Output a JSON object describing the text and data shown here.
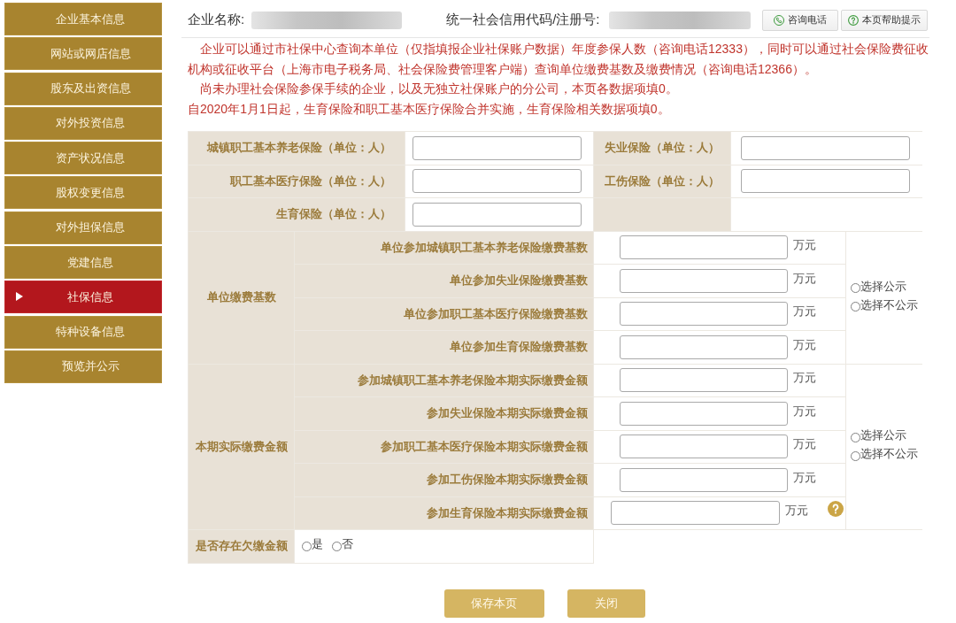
{
  "sidebar": {
    "items": [
      {
        "label": "企业基本信息",
        "selected": false
      },
      {
        "label": "网站或网店信息",
        "selected": false
      },
      {
        "label": "股东及出资信息",
        "selected": false
      },
      {
        "label": "对外投资信息",
        "selected": false
      },
      {
        "label": "资产状况信息",
        "selected": false
      },
      {
        "label": "股权变更信息",
        "selected": false
      },
      {
        "label": "对外担保信息",
        "selected": false
      },
      {
        "label": "党建信息",
        "selected": false
      },
      {
        "label": "社保信息",
        "selected": true
      },
      {
        "label": "特种设备信息",
        "selected": false
      },
      {
        "label": "预览并公示",
        "selected": false
      }
    ]
  },
  "header": {
    "fields": [
      {
        "label": "企业名称:"
      },
      {
        "label": "统一社会信用代码/注册号:"
      }
    ],
    "buttons": [
      {
        "label": "咨询电话",
        "kind": "phone"
      },
      {
        "label": "本页帮助提示",
        "kind": "help"
      }
    ]
  },
  "notice": {
    "paragraphs": [
      {
        "text": "企业可以通过市社保中心查询本单位（仅指填报企业社保账户数据）年度参保人数（咨询电话12333），同时可以通过社会保险费征收机构或征收平台（上海市电子税务局、社会保险费管理客户端）查询单位缴费基数及缴费情况（咨询电话12366）。",
        "indented": true
      },
      {
        "text": "尚未办理社会保险参保手续的企业，以及无独立社保账户的分公司，本页各数据项填0。",
        "indented": true
      },
      {
        "text": "自2020年1月1日起，生育保险和职工基本医疗保险合并实施，生育保险相关数据项填0。",
        "indented": false
      }
    ]
  },
  "headcount": {
    "fields": [
      {
        "label": "城镇职工基本养老保险（单位：人）"
      },
      {
        "label": "失业保险（单位：人）"
      },
      {
        "label": "职工基本医疗保险（单位：人）"
      },
      {
        "label": "工伤保险（单位：人）"
      },
      {
        "label": "生育保险（单位：人）"
      }
    ]
  },
  "sections": [
    {
      "title": "单位缴费基数",
      "rows": [
        {
          "label": "单位参加城镇职工基本养老保险缴费基数",
          "unit": "万元"
        },
        {
          "label": "单位参加失业保险缴费基数",
          "unit": "万元"
        },
        {
          "label": "单位参加职工基本医疗保险缴费基数",
          "unit": "万元"
        },
        {
          "label": "单位参加生育保险缴费基数",
          "unit": "万元"
        }
      ],
      "options": [
        {
          "label": "选择公示",
          "selected": false
        },
        {
          "label": "选择不公示",
          "selected": false
        }
      ]
    },
    {
      "title": "本期实际缴费金额",
      "rows": [
        {
          "label": "参加城镇职工基本养老保险本期实际缴费金额",
          "unit": "万元"
        },
        {
          "label": "参加失业保险本期实际缴费金额",
          "unit": "万元"
        },
        {
          "label": "参加职工基本医疗保险本期实际缴费金额",
          "unit": "万元"
        },
        {
          "label": "参加工伤保险本期实际缴费金额",
          "unit": "万元"
        },
        {
          "label": "参加生育保险本期实际缴费金额",
          "unit": "万元",
          "help": true
        }
      ],
      "options": [
        {
          "label": "选择公示",
          "selected": false
        },
        {
          "label": "选择不公示",
          "selected": false
        }
      ]
    }
  ],
  "arrears": {
    "label": "是否存在欠缴金额",
    "options": [
      {
        "label": "是",
        "selected": false
      },
      {
        "label": "否",
        "selected": false
      }
    ]
  },
  "actions": [
    {
      "label": "保存本页"
    },
    {
      "label": "关闭"
    }
  ]
}
